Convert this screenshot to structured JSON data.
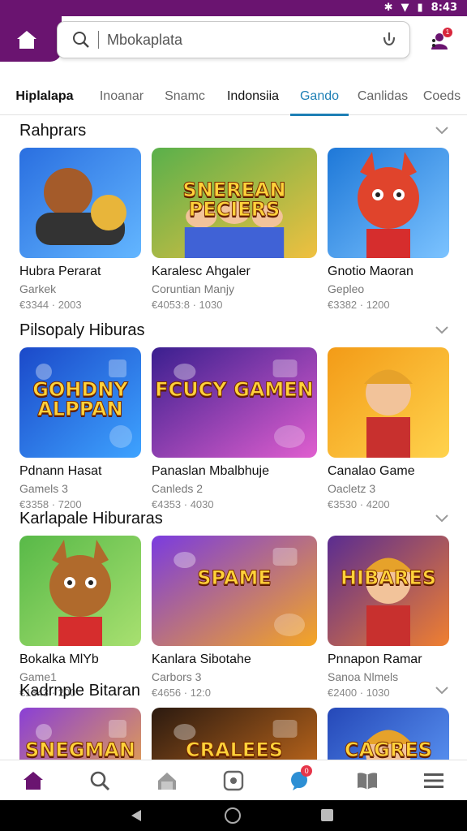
{
  "status": {
    "time": "8:43"
  },
  "search": {
    "value": "Mbokaplata"
  },
  "tabs": [
    {
      "label": "Hiplalapa",
      "style": "first"
    },
    {
      "label": "Inoanar",
      "style": ""
    },
    {
      "label": "Snamc",
      "style": ""
    },
    {
      "label": "Indonsiia",
      "style": "bold"
    },
    {
      "label": "Gando",
      "style": "active"
    },
    {
      "label": "Canlidas",
      "style": ""
    },
    {
      "label": "Coeds",
      "style": ""
    }
  ],
  "sections": [
    {
      "title": "Rahprars",
      "cards": [
        {
          "title": "Hubra Perarat",
          "sub": "Garkek",
          "price": "€3344 · 2003",
          "thumb": "controller"
        },
        {
          "title": "Karalesс Ahgaler",
          "sub": "Coruntian Manjy",
          "price": "€4053:8 · 1030",
          "thumb": "party",
          "art_text": "SNEREAN PECIERS"
        },
        {
          "title": "Gnotio Maoran",
          "sub": "Gepleo",
          "price": "€3382 · 1200",
          "thumb": "fox"
        }
      ]
    },
    {
      "title": "Pilsopaly Hiburas",
      "cards": [
        {
          "title": "Pdnann Hasat",
          "sub": "Gamels 3",
          "price": "€3358 · 7200",
          "thumb": "text-blue",
          "art_text": "GOHDNY ALPPAN"
        },
        {
          "title": "Panaslan Mbalbhuje",
          "sub": "Canleds 2",
          "price": "€4353 · 4030",
          "thumb": "text-purple",
          "art_text": "FCUCY GAMEN"
        },
        {
          "title": "Canalao Game",
          "sub": "Oacletz 3",
          "price": "€3530 · 4200",
          "thumb": "kid"
        }
      ]
    },
    {
      "title": "Karlapale Hiburaras",
      "cards": [
        {
          "title": "Bokalka MlYb",
          "sub": "Game1",
          "price": "€1343 · 200",
          "thumb": "dog"
        },
        {
          "title": "Kanlara Sibotahe",
          "sub": "Carbors 3",
          "price": "€4656 · 12:0",
          "thumb": "spame",
          "art_text": "SPAME"
        },
        {
          "title": "Pnnapon Ramar",
          "sub": "Sanoa Nlmels",
          "price": "€2400 · 1030",
          "thumb": "hibares",
          "art_text": "HIBARES"
        }
      ]
    },
    {
      "title": "Kadrnple Bitaran",
      "cards": [
        {
          "title": "",
          "sub": "",
          "price": "",
          "thumb": "purple",
          "art_text": "SNEGMAN"
        },
        {
          "title": "",
          "sub": "",
          "price": "",
          "thumb": "dark",
          "art_text": "CRALEES"
        },
        {
          "title": "",
          "sub": "",
          "price": "",
          "thumb": "blue-kid",
          "art_text": "CAGRES"
        }
      ]
    }
  ],
  "nav_badges": {
    "notifications": "0"
  },
  "colors": {
    "brand": "#6a1470",
    "tab_active": "#1d7fb5"
  }
}
